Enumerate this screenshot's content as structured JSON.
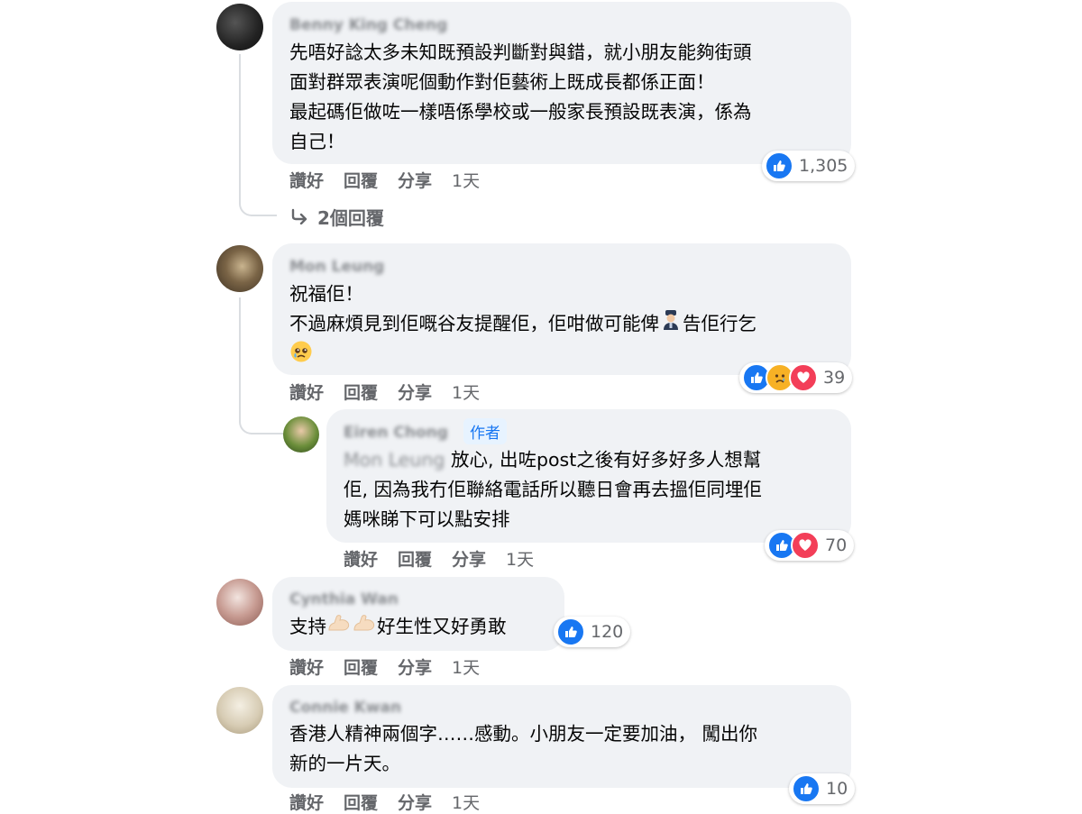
{
  "comments": [
    {
      "name": "Benny King Cheng",
      "lines": [
        "先唔好諗太多未知既預設判斷對與錯，就小朋友能夠街頭",
        "面對群眾表演呢個動作對佢藝術上既成長都係正面！",
        "最起碼佢做咗一樣唔係學校或一般家長預設既表演，係為",
        "自己！"
      ],
      "actions": {
        "like": "讚好",
        "reply": "回覆",
        "share": "分享",
        "time": "1天"
      },
      "reaction_count": "1,305",
      "replies_link": "2個回覆"
    },
    {
      "name": "Mon Leung",
      "line1": "祝福佢！",
      "line2_a": "不過麻煩見到佢嘅谷友提醒佢，佢咁做可能俾",
      "line2_b": "告佢行乞",
      "actions": {
        "like": "讚好",
        "reply": "回覆",
        "share": "分享",
        "time": "1天"
      },
      "reaction_count": "39"
    },
    {
      "name": "Eiren Chong",
      "badge": "作者",
      "tag": "Mon Leung",
      "line1": "放心, 出咗post之後有好多好多人想幫",
      "line2": "佢, 因為我冇佢聯絡電話所以聽日會再去搵佢同埋佢",
      "line3": "媽咪睇下可以點安排",
      "actions": {
        "like": "讚好",
        "reply": "回覆",
        "share": "分享",
        "time": "1天"
      },
      "reaction_count": "70"
    },
    {
      "name": "Cynthia Wan",
      "text_a": "支持",
      "text_b": "好生性又好勇敢",
      "actions": {
        "like": "讚好",
        "reply": "回覆",
        "share": "分享",
        "time": "1天"
      },
      "reaction_count": "120"
    },
    {
      "name": "Connie Kwan",
      "line1": "香港人精神兩個字……感動。小朋友一定要加油， 闖出你",
      "line2": "新的一片天。",
      "actions": {
        "like": "讚好",
        "reply": "回覆",
        "share": "分享",
        "time": "1天"
      },
      "reaction_count": "10"
    }
  ],
  "icons": {
    "like": "thumbs-up-icon",
    "love": "heart-icon",
    "sad": "sad-face-icon",
    "reply_arrow": "reply-arrow-icon",
    "police": "police-officer-icon",
    "tear": "pleading-face-icon",
    "muscle": "flexed-biceps-icon"
  },
  "colors": {
    "like": "#1877f2",
    "love": "#f33e58",
    "sad": "#f7b125",
    "bubble": "#f0f2f5",
    "meta": "#65676b"
  }
}
